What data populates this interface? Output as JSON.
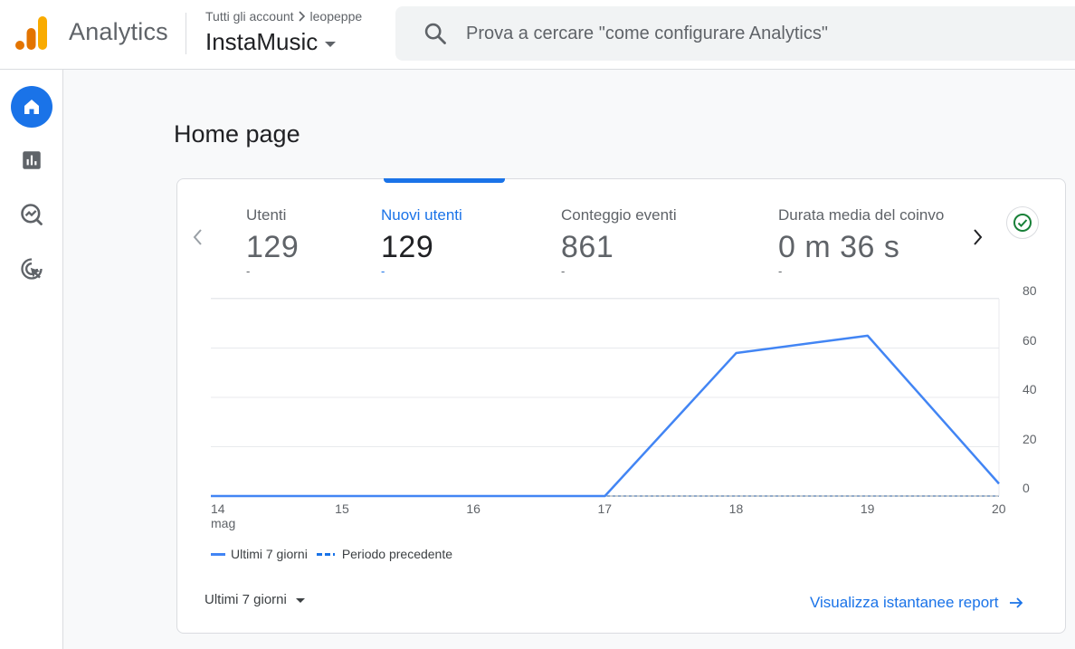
{
  "header": {
    "app_name": "Analytics",
    "breadcrumb": {
      "root": "Tutti gli account",
      "account": "leopeppe"
    },
    "property_name": "InstaMusic",
    "search_placeholder": "Prova a cercare \"come configurare Analytics\""
  },
  "sidenav": {
    "items": [
      {
        "icon": "home-icon",
        "active": true
      },
      {
        "icon": "reports-icon",
        "active": false
      },
      {
        "icon": "explore-icon",
        "active": false
      },
      {
        "icon": "advertising-icon",
        "active": false
      }
    ]
  },
  "page": {
    "title": "Home page"
  },
  "metrics": [
    {
      "label": "Utenti",
      "value": "129",
      "delta": "-",
      "active": false
    },
    {
      "label": "Nuovi utenti",
      "value": "129",
      "delta": "-",
      "active": true
    },
    {
      "label": "Conteggio eventi",
      "value": "861",
      "delta": "-",
      "active": false
    },
    {
      "label": "Durata media del coinvo",
      "value": "0 m 36 s",
      "delta": "-",
      "active": false
    }
  ],
  "colors": {
    "accent": "#1a73e8",
    "series_current": "#4285f4",
    "success": "#188038"
  },
  "chart_data": {
    "type": "line",
    "categories": [
      "14",
      "15",
      "16",
      "17",
      "18",
      "19",
      "20"
    ],
    "x_sublabel": "mag",
    "series": [
      {
        "name": "Ultimi 7 giorni",
        "values": [
          0,
          0,
          0,
          0,
          58,
          65,
          5
        ],
        "style": "solid"
      },
      {
        "name": "Periodo precedente",
        "values": [
          0,
          0,
          0,
          0,
          0,
          0,
          0
        ],
        "style": "dashed"
      }
    ],
    "y_ticks": [
      "80",
      "60",
      "40",
      "20",
      "0"
    ],
    "ylim": [
      0,
      80
    ],
    "grid": true,
    "legend": "bottom-left"
  },
  "footer": {
    "range_label": "Ultimi 7 giorni",
    "report_link": "Visualizza istantanee report"
  }
}
